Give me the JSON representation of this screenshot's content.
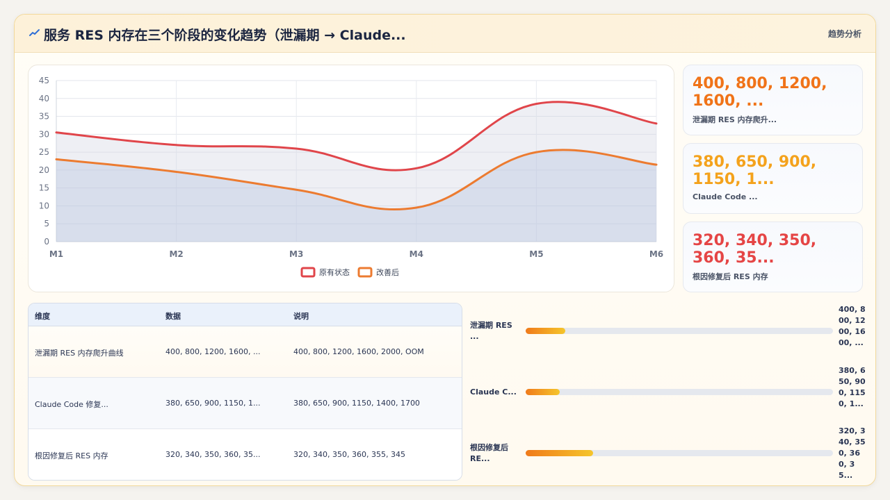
{
  "header": {
    "title": "服务 RES 内存在三个阶段的变化趋势（泄漏期 → Claude...",
    "title_icon": "trend-line-icon",
    "action_label": "趋势分析"
  },
  "chart_data": {
    "type": "area",
    "categories": [
      "M1",
      "M2",
      "M3",
      "M4",
      "M5",
      "M6"
    ],
    "y_ticks": [
      "0",
      "5",
      "10",
      "15",
      "20",
      "25",
      "30",
      "35",
      "40",
      "45"
    ],
    "ylim": [
      0,
      45
    ],
    "grid": true,
    "legend_position": "bottom",
    "series": [
      {
        "name": "原有状态",
        "values": [
          30.5,
          27,
          26,
          20.5,
          38.5,
          33
        ],
        "color": "#e0454a"
      },
      {
        "name": "改善后",
        "values": [
          23,
          19.5,
          14.5,
          9.5,
          25,
          21.5
        ],
        "color": "#ec7b30"
      }
    ]
  },
  "stats": [
    {
      "value": "400, 800, 1200, 1600, ...",
      "label": "泄漏期 RES 内存爬升...",
      "color": "#f07318"
    },
    {
      "value": "380, 650, 900, 1150, 1...",
      "label": "Claude Code ...",
      "color": "#f4a21c"
    },
    {
      "value": "320, 340, 350, 360, 35...",
      "label": "根因修复后 RES 内存",
      "color": "#e54545"
    }
  ],
  "table": {
    "headers": [
      "维度",
      "数据",
      "说明"
    ],
    "rows": [
      [
        "泄漏期 RES 内存爬升曲线",
        "400, 800, 1200, 1600, ...",
        "400, 800, 1200, 1600, 2000, OOM"
      ],
      [
        "Claude Code 修复...",
        "380, 650, 900, 1150, 1...",
        "380, 650, 900, 1150, 1400, 1700"
      ],
      [
        "根因修复后 RES 内存",
        "320, 340, 350, 360, 35...",
        "320, 340, 350, 360, 355, 345"
      ]
    ]
  },
  "bars": [
    {
      "label": "泄漏期 RES ...",
      "value": "400, 800, 1200, 1600, ...",
      "fraction": 0.13
    },
    {
      "label": "Claude C...",
      "value": "380, 650, 900, 1150, 1...",
      "fraction": 0.11
    },
    {
      "label": "根因修复后 RE...",
      "value": "320, 340, 350, 360, 35...",
      "fraction": 0.22
    }
  ]
}
